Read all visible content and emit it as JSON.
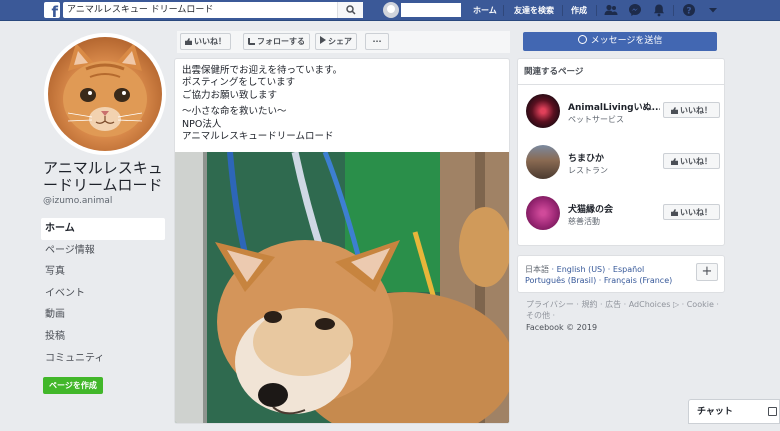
{
  "topbar": {
    "search_value": "アニマルレスキュー ドリームロード",
    "home_link": "ホーム",
    "find_friends_link": "友達を検索",
    "create_link": "作成",
    "logo_letter": "f"
  },
  "page": {
    "name": "アニマルレスキュードリームロード",
    "handle": "@izumo.animal",
    "nav": [
      "ホーム",
      "ページ情報",
      "写真",
      "イベント",
      "動画",
      "投稿",
      "コミュニティ"
    ],
    "create_page_label": "ページを作成"
  },
  "actions": {
    "like": "いいね！",
    "follow": "フォローする",
    "share": "シェア",
    "more": "···",
    "message": "メッセージを送信"
  },
  "post": {
    "lines": [
      "出雲保健所でお迎えを待っています。",
      "ポスティングをしています",
      "ご協力お願い致します",
      "〜小さな命を救いたい〜",
      "NPO法人",
      "アニマルレスキュードリームロード"
    ]
  },
  "related": {
    "title": "関連するページ",
    "items": [
      {
        "name": "AnimalLivingいぬ...",
        "category": "ペットサービス",
        "like": "いいね！"
      },
      {
        "name": "ちまひか",
        "category": "レストラン",
        "like": "いいね！"
      },
      {
        "name": "犬猫縁の会",
        "category": "慈善活動",
        "like": "いいね！"
      }
    ]
  },
  "languages": {
    "current": "日本語",
    "list": [
      "English (US)",
      "Español",
      "Português (Brasil)",
      "Français (France)"
    ],
    "add": "+"
  },
  "footer": {
    "links": "プライバシー · 規約 · 広告 · AdChoices ▷ · Cookie · その他 ·",
    "copyright": "Facebook © 2019"
  },
  "chat": {
    "label": "チャット"
  },
  "colors": {
    "brand": "#3b5998",
    "button_blue": "#4267b2",
    "create_green": "#42b72a"
  }
}
